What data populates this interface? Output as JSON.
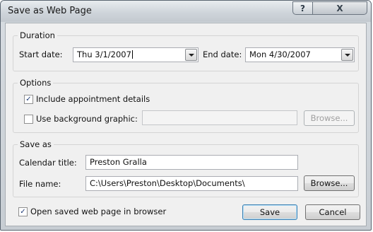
{
  "window": {
    "title": "Save as Web Page",
    "help_glyph": "?",
    "close_glyph": "X"
  },
  "duration": {
    "group_label": "Duration",
    "start_label": "Start date:",
    "start_value": "Thu 3/1/2007",
    "end_label": "End date:",
    "end_value": "Mon 4/30/2007"
  },
  "options": {
    "group_label": "Options",
    "include_details_label": "Include appointment details",
    "include_details_checked": true,
    "background_label": "Use background graphic:",
    "background_checked": false,
    "background_value": "",
    "browse_label": "Browse..."
  },
  "save_as": {
    "group_label": "Save as",
    "title_label": "Calendar title:",
    "title_value": "Preston Gralla",
    "file_label": "File name:",
    "file_value": "C:\\Users\\Preston\\Desktop\\Documents\\",
    "browse_label": "Browse..."
  },
  "footer": {
    "open_in_browser_label": "Open saved web page in browser",
    "open_in_browser_checked": true,
    "save_label": "Save",
    "cancel_label": "Cancel"
  },
  "icons": {
    "checkmark": "✓"
  }
}
